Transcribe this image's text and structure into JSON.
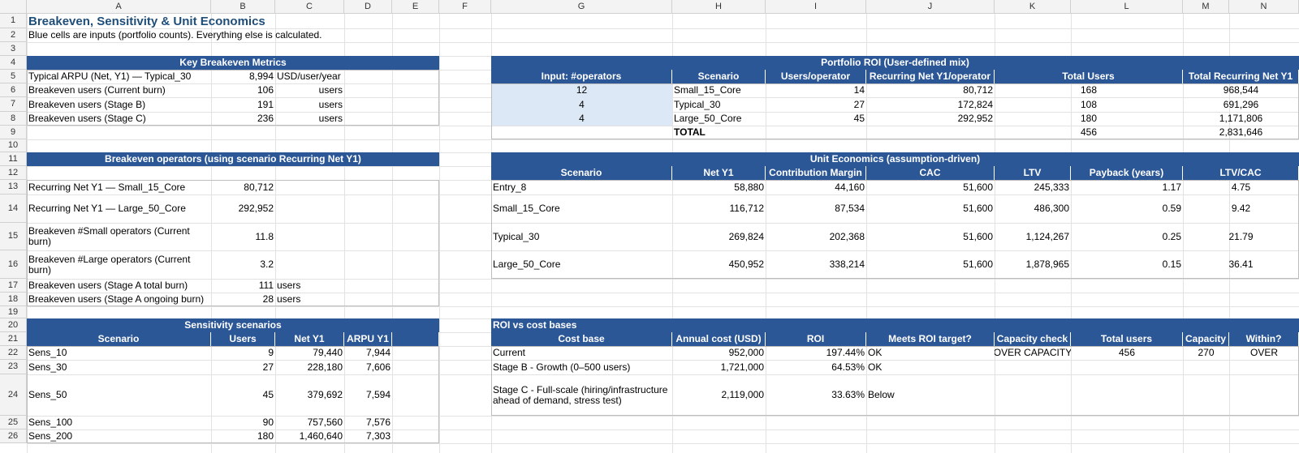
{
  "columns": [
    "A",
    "B",
    "C",
    "D",
    "E",
    "F",
    "G",
    "H",
    "I",
    "J",
    "K",
    "L",
    "M",
    "N"
  ],
  "rows": [
    "1",
    "2",
    "3",
    "4",
    "5",
    "6",
    "7",
    "8",
    "9",
    "10",
    "11",
    "12",
    "13",
    "14",
    "15",
    "16",
    "17",
    "18",
    "19",
    "20",
    "21",
    "22",
    "23",
    "24",
    "25",
    "26"
  ],
  "title": "Breakeven, Sensitivity & Unit Economics",
  "subtitle": "Blue cells are inputs (portfolio counts). Everything else is calculated.",
  "key_metrics": {
    "header": "Key Breakeven Metrics",
    "rows": [
      {
        "label": "Typical ARPU (Net, Y1) — Typical_30",
        "value": "8,994",
        "unit": "USD/user/year"
      },
      {
        "label": "Breakeven users (Current burn)",
        "value": "106",
        "unit": "users"
      },
      {
        "label": "Breakeven users (Stage B)",
        "value": "191",
        "unit": "users"
      },
      {
        "label": "Breakeven users (Stage C)",
        "value": "236",
        "unit": "users"
      }
    ]
  },
  "breakeven_ops": {
    "header": "Breakeven operators (using scenario Recurring Net Y1)",
    "rows": [
      {
        "label": "Recurring Net Y1 — Small_15_Core",
        "value": "80,712",
        "unit": ""
      },
      {
        "label": "Recurring Net Y1 — Large_50_Core",
        "value": "292,952",
        "unit": ""
      },
      {
        "label": "Breakeven #Small operators (Current burn)",
        "value": "11.8",
        "unit": ""
      },
      {
        "label": "Breakeven #Large operators (Current burn)",
        "value": "3.2",
        "unit": ""
      },
      {
        "label": "Breakeven users (Stage A total burn)",
        "value": "111",
        "unit": "users"
      },
      {
        "label": "Breakeven users (Stage A ongoing burn)",
        "value": "28",
        "unit": "users"
      }
    ]
  },
  "sensitivity": {
    "header": "Sensitivity scenarios",
    "columns": [
      "Scenario",
      "Users",
      "Net Y1",
      "ARPU Y1"
    ],
    "rows": [
      [
        "Sens_10",
        "9",
        "79,440",
        "7,944"
      ],
      [
        "Sens_30",
        "27",
        "228,180",
        "7,606"
      ],
      [
        "Sens_50",
        "45",
        "379,692",
        "7,594"
      ],
      [
        "Sens_100",
        "90",
        "757,560",
        "7,576"
      ],
      [
        "Sens_200",
        "180",
        "1,460,640",
        "7,303"
      ]
    ]
  },
  "portfolio": {
    "header": "Portfolio ROI (User-defined mix)",
    "columns": [
      "Input: #operators",
      "Scenario",
      "Users/operator",
      "Recurring Net Y1/operator",
      "Total Users",
      "Total Recurring Net Y1"
    ],
    "rows": [
      [
        "12",
        "Small_15_Core",
        "14",
        "80,712",
        "168",
        "968,544"
      ],
      [
        "4",
        "Typical_30",
        "27",
        "172,824",
        "108",
        "691,296"
      ],
      [
        "4",
        "Large_50_Core",
        "45",
        "292,952",
        "180",
        "1,171,806"
      ]
    ],
    "total_label": "TOTAL",
    "total_users": "456",
    "total_net": "2,831,646"
  },
  "unit_econ": {
    "header": "Unit Economics (assumption-driven)",
    "columns": [
      "Scenario",
      "Net Y1",
      "Contribution Margin",
      "CAC",
      "LTV",
      "Payback (years)",
      "LTV/CAC"
    ],
    "rows": [
      [
        "Entry_8",
        "58,880",
        "44,160",
        "51,600",
        "245,333",
        "1.17",
        "4.75"
      ],
      [
        "Small_15_Core",
        "116,712",
        "87,534",
        "51,600",
        "486,300",
        "0.59",
        "9.42"
      ],
      [
        "Typical_30",
        "269,824",
        "202,368",
        "51,600",
        "1,124,267",
        "0.25",
        "21.79"
      ],
      [
        "Large_50_Core",
        "450,952",
        "338,214",
        "51,600",
        "1,878,965",
        "0.15",
        "36.41"
      ]
    ]
  },
  "roi": {
    "header": "ROI vs cost bases",
    "columns": [
      "Cost base",
      "Annual cost (USD)",
      "ROI",
      "Meets ROI target?",
      "Capacity check",
      "Total users",
      "Capacity",
      "Within?"
    ],
    "rows": [
      [
        "Current",
        "952,000",
        "197.44%",
        "OK",
        "OVER CAPACITY",
        "456",
        "270",
        "OVER"
      ],
      [
        "Stage B - Growth (0–500 users)",
        "1,721,000",
        "64.53%",
        "OK",
        "",
        "",
        "",
        ""
      ],
      [
        "Stage C - Full-scale (hiring/infrastructure ahead of demand, stress test)",
        "2,119,000",
        "33.63%",
        "Below",
        "",
        "",
        "",
        ""
      ]
    ]
  },
  "colors": {
    "band": "#2c5797",
    "input": "#dce8f5",
    "title": "#1f4e79"
  }
}
